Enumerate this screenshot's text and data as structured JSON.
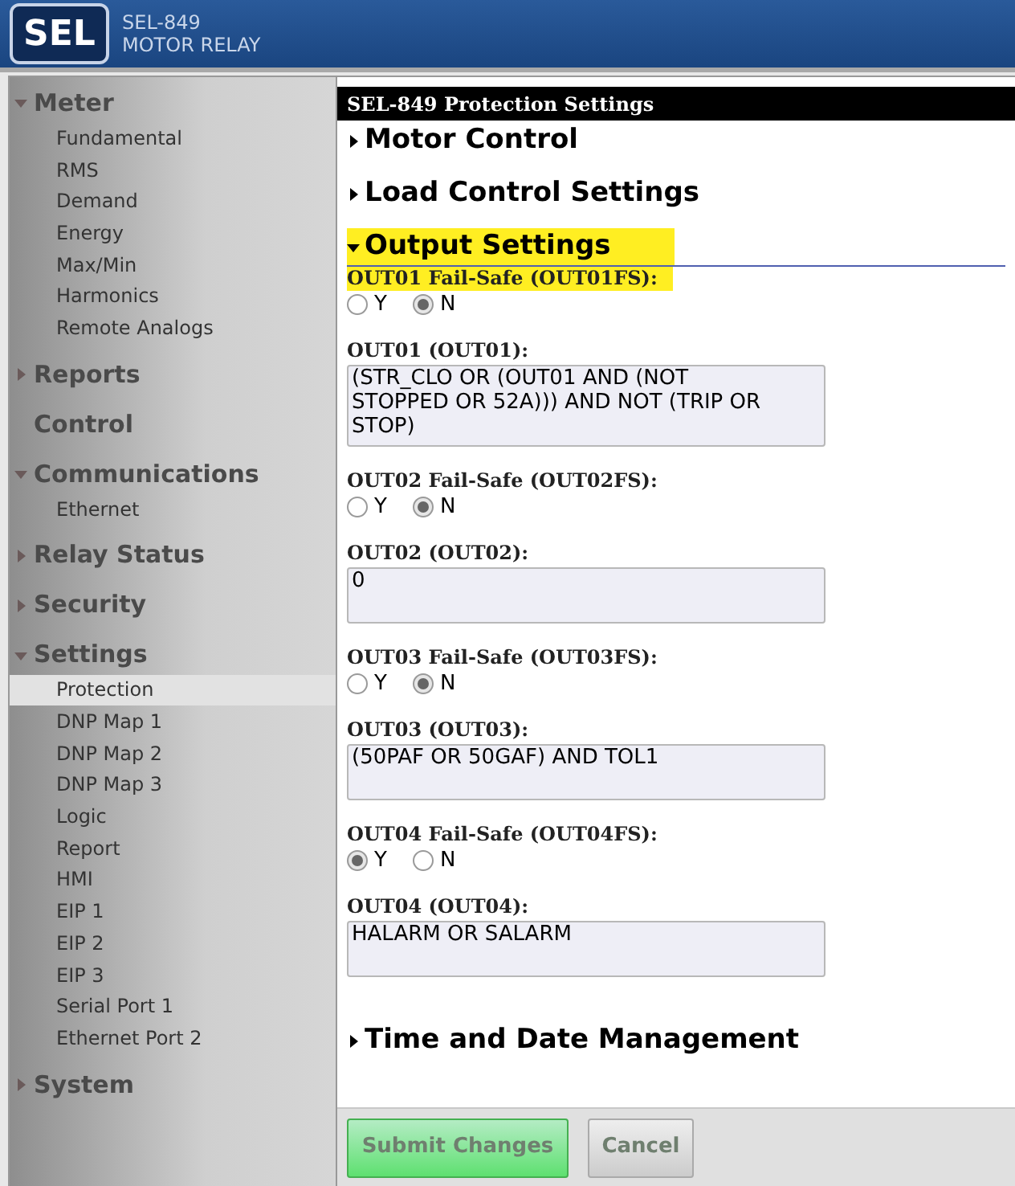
{
  "header": {
    "logo": "SEL",
    "model": "SEL-849",
    "product": "MOTOR RELAY"
  },
  "sidebar": [
    {
      "label": "Meter",
      "expanded": true,
      "items": [
        {
          "label": "Fundamental",
          "selected": false
        },
        {
          "label": "RMS",
          "selected": false
        },
        {
          "label": "Demand",
          "selected": false
        },
        {
          "label": "Energy",
          "selected": false
        },
        {
          "label": "Max/Min",
          "selected": false
        },
        {
          "label": "Harmonics",
          "selected": false
        },
        {
          "label": "Remote Analogs",
          "selected": false
        }
      ]
    },
    {
      "label": "Reports",
      "expanded": false
    },
    {
      "label": "Control"
    },
    {
      "label": "Communications",
      "expanded": true,
      "items": [
        {
          "label": "Ethernet",
          "selected": false
        }
      ]
    },
    {
      "label": "Relay Status",
      "expanded": false
    },
    {
      "label": "Security",
      "expanded": false
    },
    {
      "label": "Settings",
      "expanded": true,
      "items": [
        {
          "label": "Protection",
          "selected": true
        },
        {
          "label": "DNP Map 1",
          "selected": false
        },
        {
          "label": "DNP Map 2",
          "selected": false
        },
        {
          "label": "DNP Map 3",
          "selected": false
        },
        {
          "label": "Logic",
          "selected": false
        },
        {
          "label": "Report",
          "selected": false
        },
        {
          "label": "HMI",
          "selected": false
        },
        {
          "label": "EIP 1",
          "selected": false
        },
        {
          "label": "EIP 2",
          "selected": false
        },
        {
          "label": "EIP 3",
          "selected": false
        },
        {
          "label": "Serial Port 1",
          "selected": false
        },
        {
          "label": "Ethernet Port 2",
          "selected": false
        }
      ]
    },
    {
      "label": "System",
      "expanded": false
    }
  ],
  "content": {
    "title": "SEL-849 Protection Settings",
    "sections": [
      {
        "label": "Motor Control",
        "expanded": false,
        "highlighted": false
      },
      {
        "label": "Load Control Settings",
        "expanded": false,
        "highlighted": false
      },
      {
        "label": "Output Settings",
        "expanded": true,
        "highlighted": true,
        "fields": [
          {
            "kind": "radio",
            "label": "OUT01 Fail-Safe  (OUT01FS):",
            "highlighted": true,
            "options": [
              {
                "label": "Y",
                "selected": false
              },
              {
                "label": "N",
                "selected": true
              }
            ]
          },
          {
            "kind": "text",
            "label": "OUT01  (OUT01):",
            "highlighted": false,
            "value": "(STR_CLO OR (OUT01 AND (NOT STOPPED OR 52A))) AND NOT (TRIP OR STOP)"
          },
          {
            "kind": "radio",
            "label": "OUT02 Fail-Safe  (OUT02FS):",
            "highlighted": false,
            "options": [
              {
                "label": "Y",
                "selected": false
              },
              {
                "label": "N",
                "selected": true
              }
            ]
          },
          {
            "kind": "text",
            "label": "OUT02  (OUT02):",
            "highlighted": false,
            "value": "0"
          },
          {
            "kind": "radio",
            "label": "OUT03 Fail-Safe  (OUT03FS):",
            "highlighted": false,
            "options": [
              {
                "label": "Y",
                "selected": false
              },
              {
                "label": "N",
                "selected": true
              }
            ]
          },
          {
            "kind": "text",
            "label": "OUT03  (OUT03):",
            "highlighted": false,
            "value": "(50PAF OR 50GAF) AND TOL1"
          },
          {
            "kind": "radio",
            "label": "OUT04 Fail-Safe  (OUT04FS):",
            "highlighted": false,
            "options": [
              {
                "label": "Y",
                "selected": true
              },
              {
                "label": "N",
                "selected": false
              }
            ]
          },
          {
            "kind": "text",
            "label": "OUT04  (OUT04):",
            "highlighted": false,
            "value": "HALARM OR SALARM"
          }
        ]
      },
      {
        "label": "Time and Date Management",
        "expanded": false,
        "highlighted": false
      }
    ]
  },
  "buttons": [
    {
      "kind": "submit",
      "label": "Submit Changes",
      "disabled": true
    },
    {
      "kind": "cancel",
      "label": "Cancel",
      "disabled": true
    }
  ]
}
